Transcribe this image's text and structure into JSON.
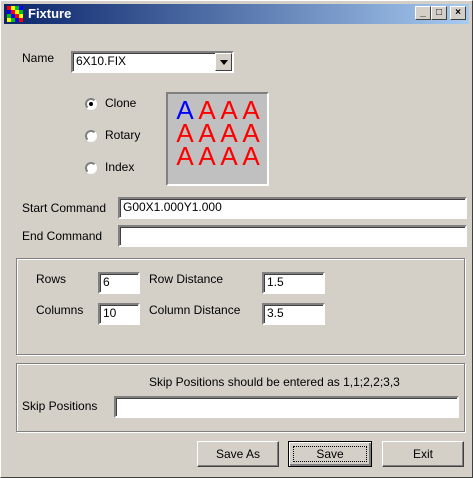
{
  "window": {
    "title": "Fixture",
    "buttons": {
      "minimize": "_",
      "maximize": "□",
      "close": "×"
    }
  },
  "name_field": {
    "label": "Name",
    "value": "6X10.FIX"
  },
  "mode": {
    "options": [
      "Clone",
      "Rotary",
      "Index"
    ],
    "selected": "Clone"
  },
  "preview": {
    "cells": [
      [
        "A",
        "A",
        "A",
        "A"
      ],
      [
        "A",
        "A",
        "A",
        "A"
      ],
      [
        "A",
        "A",
        "A",
        "A"
      ]
    ],
    "first_cell_color": "#0000ff",
    "cell_color": "#ff0000"
  },
  "commands": {
    "start_label": "Start Command",
    "start_value": "G00X1.000Y1.000",
    "end_label": "End Command",
    "end_value": ""
  },
  "layout_group": {
    "rows_label": "Rows",
    "rows_value": "6",
    "columns_label": "Columns",
    "columns_value": "10",
    "row_distance_label": "Row Distance",
    "row_distance_value": "1.5",
    "column_distance_label": "Column Distance",
    "column_distance_value": "3.5"
  },
  "skip": {
    "hint": "Skip Positions should be entered as 1,1;2,2;3,3",
    "label": "Skip Positions",
    "value": ""
  },
  "footer": {
    "save_as": "Save As",
    "save": "Save",
    "exit": "Exit"
  }
}
